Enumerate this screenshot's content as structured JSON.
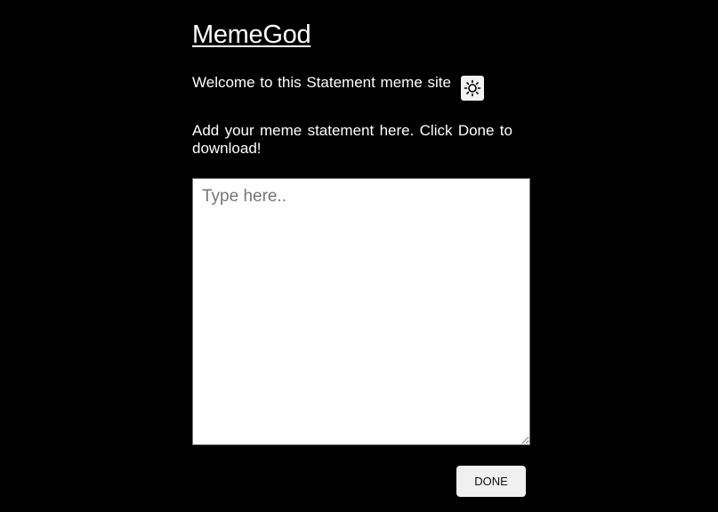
{
  "header": {
    "title": "MemeGod"
  },
  "intro": {
    "welcome_text": "Welcome to this Statement meme site",
    "theme_toggle_icon": "sun-icon"
  },
  "editor": {
    "instructions": "Add your meme statement here. Click Done to download!",
    "placeholder": "Type here..",
    "value": ""
  },
  "actions": {
    "done_label": "DONE"
  },
  "colors": {
    "background": "#000000",
    "text": "#ffffff",
    "button_bg": "#f0f0f0"
  }
}
